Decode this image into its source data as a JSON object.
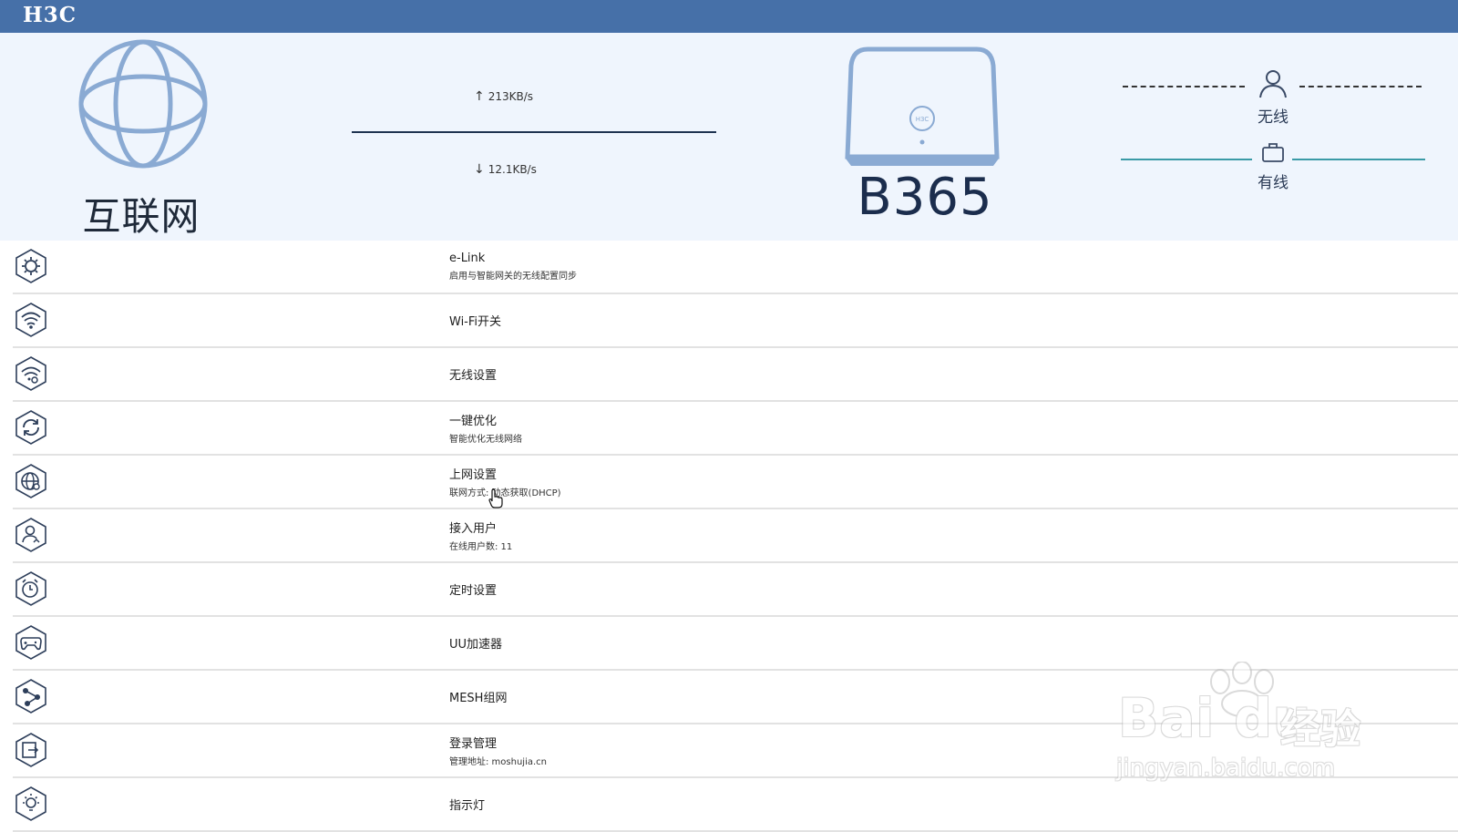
{
  "header": {
    "logo_text": "H3C",
    "bar_color": "#4670a8"
  },
  "status": {
    "internet_label": "互联网",
    "upload_speed": "213KB/s",
    "download_speed": "12.1KB/s",
    "router_model": "B365",
    "router_badge": "H3C",
    "wireless_label": "无线",
    "wired_label": "有线"
  },
  "menu": [
    {
      "icon": "gear-icon",
      "title": "e-Link",
      "subtitle": "启用与智能网关的无线配置同步"
    },
    {
      "icon": "wifi-icon",
      "title": "Wi-Fi开关",
      "subtitle": ""
    },
    {
      "icon": "wifi-settings-icon",
      "title": "无线设置",
      "subtitle": ""
    },
    {
      "icon": "refresh-icon",
      "title": "一键优化",
      "subtitle": "智能优化无线网络"
    },
    {
      "icon": "globe-settings-icon",
      "title": "上网设置",
      "subtitle": "联网方式: 动态获取(DHCP)"
    },
    {
      "icon": "user-icon",
      "title": "接入用户",
      "subtitle": "在线用户数: 11"
    },
    {
      "icon": "alarm-clock-icon",
      "title": "定时设置",
      "subtitle": ""
    },
    {
      "icon": "gamepad-icon",
      "title": "UU加速器",
      "subtitle": ""
    },
    {
      "icon": "share-icon",
      "title": "MESH组网",
      "subtitle": ""
    },
    {
      "icon": "login-icon",
      "title": "登录管理",
      "subtitle": "管理地址: moshujia.cn"
    },
    {
      "icon": "bulb-icon",
      "title": "指示灯",
      "subtitle": ""
    }
  ],
  "watermark": {
    "brand": "Bai du",
    "cn": "经验",
    "url": "jingyan.baidu.com"
  }
}
